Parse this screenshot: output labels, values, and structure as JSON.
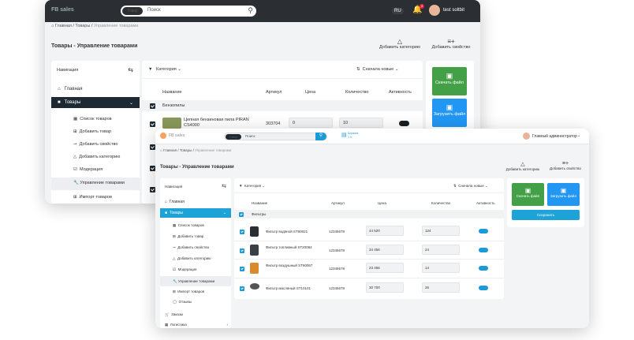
{
  "win1": {
    "logo": "FB sales",
    "search_pill": "Товар",
    "search_placeholder": "Поиск",
    "lang": "RU",
    "user": "test soltbit",
    "notif_count": "3",
    "breadcrumb": [
      "Главная",
      "Товары",
      "Управление товарами"
    ],
    "page_title": "Товары - Управление товарами",
    "actions": [
      "Добавить категорию",
      "Добавить свойство"
    ],
    "nav_title": "Навигация",
    "menu": [
      "Главная",
      "Товары",
      "Список товаров",
      "Добавить товар",
      "Добавить свойство",
      "Добавить категорию",
      "Модерация",
      "Управление товарами",
      "Импорт товаров"
    ],
    "filter": "Категория",
    "sort": "Сначала новые",
    "columns": [
      "Название",
      "Артикул",
      "Цена",
      "Количество",
      "Активность"
    ],
    "group": "Бензопилы",
    "row": {
      "name": "Цепная бензиновая пила PIRAN CS4000",
      "sku": "303704",
      "price": "0",
      "qty": "10"
    },
    "download": "Скачать файл",
    "upload": "Загрузить файл"
  },
  "win2": {
    "logo": "FB sales",
    "search_pill": "Товар",
    "search_placeholder": "Поиск",
    "cart_label": "Корзина",
    "cart_count": "1 п.",
    "user": "Главный администратор",
    "breadcrumb": [
      "Главная",
      "Товары",
      "Управление товарами"
    ],
    "page_title": "Товары - Управление товарами",
    "actions": [
      "Добавить категорию",
      "Добавить свойство"
    ],
    "nav_title": "Навигация",
    "menu": [
      "Главная",
      "Товары",
      "Список товаров",
      "Добавить товар",
      "Добавить свойство",
      "Добавить категорию",
      "Модерация",
      "Управление товарами",
      "Импорт товаров",
      "Отзывы",
      "Заказы",
      "Логистика"
    ],
    "filter": "Категория",
    "sort": "Сначала новые",
    "columns": [
      "Название",
      "Артикул",
      "Цена",
      "Количество",
      "Активность"
    ],
    "group": "Фильтры",
    "rows": [
      {
        "name": "Фильтр водяной ST60021",
        "sku": "12345678",
        "price": "44 520",
        "qty": "124"
      },
      {
        "name": "Фильтр топливный ST20084",
        "sku": "12345678",
        "price": "34 456",
        "qty": "24"
      },
      {
        "name": "Фильтр воздушный ST60067",
        "sku": "12345678",
        "price": "23 456",
        "qty": "14"
      },
      {
        "name": "Фильтр масляный ST10101",
        "sku": "12345678",
        "price": "30 700",
        "qty": "26"
      }
    ],
    "download": "Скачать файл",
    "upload": "Загрузить файл",
    "save": "Сохранить"
  }
}
